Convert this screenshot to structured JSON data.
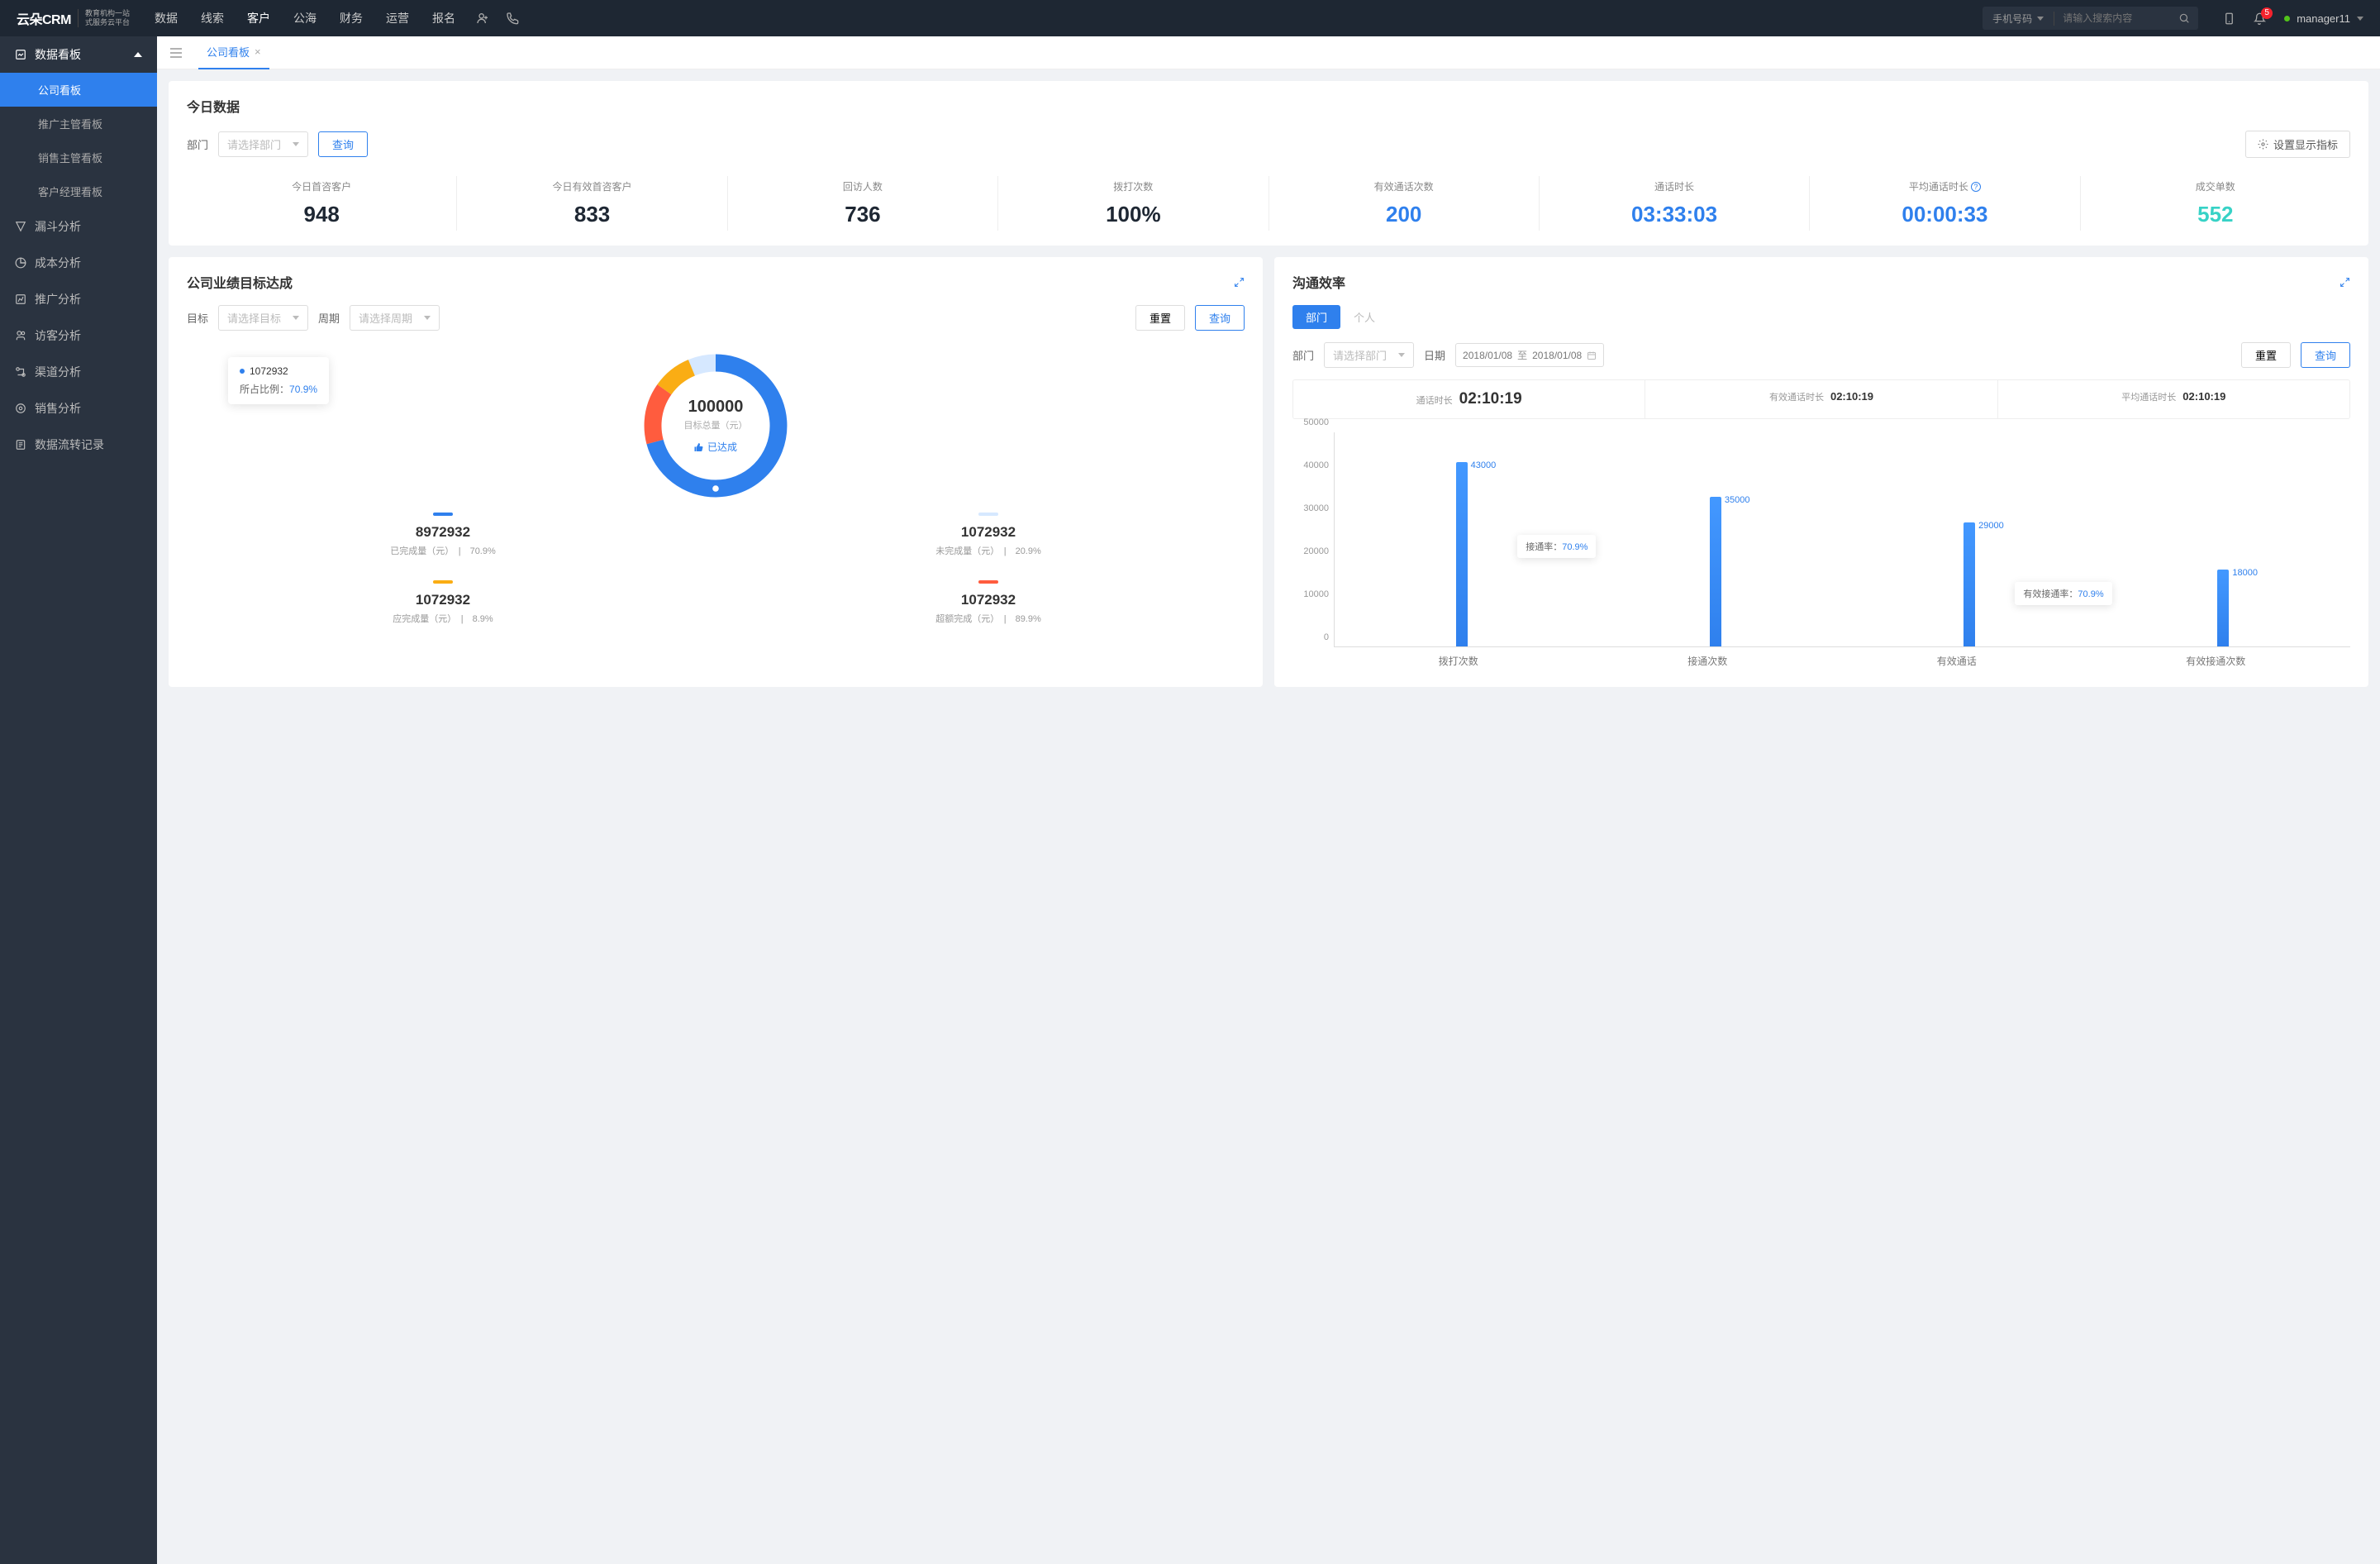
{
  "header": {
    "logo_main": "云朵CRM",
    "logo_sub1": "教育机构一站",
    "logo_sub2": "式服务云平台",
    "nav": [
      "数据",
      "线索",
      "客户",
      "公海",
      "财务",
      "运营",
      "报名"
    ],
    "nav_active_index": 2,
    "search_type": "手机号码",
    "search_placeholder": "请输入搜索内容",
    "badge_count": "5",
    "user_name": "manager11"
  },
  "sidebar": {
    "group": "数据看板",
    "subs": [
      "公司看板",
      "推广主管看板",
      "销售主管看板",
      "客户经理看板"
    ],
    "sub_active_index": 0,
    "items": [
      "漏斗分析",
      "成本分析",
      "推广分析",
      "访客分析",
      "渠道分析",
      "销售分析",
      "数据流转记录"
    ]
  },
  "tab": {
    "label": "公司看板"
  },
  "today": {
    "title": "今日数据",
    "dept_label": "部门",
    "dept_placeholder": "请选择部门",
    "query_btn": "查询",
    "settings_btn": "设置显示指标",
    "stats": [
      {
        "label": "今日首咨客户",
        "value": "948",
        "color": "c-dark"
      },
      {
        "label": "今日有效首咨客户",
        "value": "833",
        "color": "c-dark"
      },
      {
        "label": "回访人数",
        "value": "736",
        "color": "c-dark"
      },
      {
        "label": "拨打次数",
        "value": "100%",
        "color": "c-dark"
      },
      {
        "label": "有效通话次数",
        "value": "200",
        "color": "c-blue"
      },
      {
        "label": "通话时长",
        "value": "03:33:03",
        "color": "c-blue"
      },
      {
        "label": "平均通话时长",
        "value": "00:00:33",
        "color": "c-blue",
        "help": true
      },
      {
        "label": "成交单数",
        "value": "552",
        "color": "c-teal"
      }
    ]
  },
  "goal": {
    "title": "公司业绩目标达成",
    "target_label": "目标",
    "target_placeholder": "请选择目标",
    "period_label": "周期",
    "period_placeholder": "请选择周期",
    "reset_btn": "重置",
    "query_btn": "查询",
    "center_num": "100000",
    "center_sub": "目标总量（元）",
    "status": "已达成",
    "tooltip_val": "1072932",
    "tooltip_pct_lbl": "所占比例：",
    "tooltip_pct": "70.9%",
    "legend": [
      {
        "color": "#2f80ed",
        "num": "8972932",
        "txt": "已完成量（元）",
        "pct": "70.9%"
      },
      {
        "color": "#d6e8ff",
        "num": "1072932",
        "txt": "未完成量（元）",
        "pct": "20.9%"
      },
      {
        "color": "#faad14",
        "num": "1072932",
        "txt": "应完成量（元）",
        "pct": "8.9%"
      },
      {
        "color": "#ff5c3e",
        "num": "1072932",
        "txt": "超额完成（元）",
        "pct": "89.9%"
      }
    ]
  },
  "comm": {
    "title": "沟通效率",
    "pill_dept": "部门",
    "pill_person": "个人",
    "dept_label": "部门",
    "dept_placeholder": "请选择部门",
    "date_label": "日期",
    "date_from": "2018/01/08",
    "date_to": "2018/01/08",
    "date_sep": "至",
    "reset_btn": "重置",
    "query_btn": "查询",
    "kpis": [
      {
        "label": "通话时长",
        "value": "02:10:19"
      },
      {
        "label": "有效通话时长",
        "value": "02:10:19"
      },
      {
        "label": "平均通话时长",
        "value": "02:10:19"
      }
    ],
    "tooltip1_lbl": "接通率：",
    "tooltip1_val": "70.9%",
    "tooltip2_lbl": "有效接通率：",
    "tooltip2_val": "70.9%"
  },
  "chart_data": [
    {
      "type": "donut",
      "title": "公司业绩目标达成",
      "center_value": 100000,
      "center_label": "目标总量（元）",
      "status": "已达成",
      "series": [
        {
          "name": "已完成量（元）",
          "value": 8972932,
          "pct": 70.9,
          "color": "#2f80ed"
        },
        {
          "name": "未完成量（元）",
          "value": 1072932,
          "pct": 20.9,
          "color": "#d6e8ff"
        },
        {
          "name": "应完成量（元）",
          "value": 1072932,
          "pct": 8.9,
          "color": "#faad14"
        },
        {
          "name": "超额完成（元）",
          "value": 1072932,
          "pct": 89.9,
          "color": "#ff5c3e"
        }
      ]
    },
    {
      "type": "bar",
      "title": "沟通效率",
      "categories": [
        "拨打次数",
        "接通次数",
        "有效通话",
        "有效接通次数"
      ],
      "values": [
        43000,
        35000,
        29000,
        18000
      ],
      "ylabel": "",
      "xlabel": "",
      "ylim": [
        0,
        50000
      ],
      "y_ticks": [
        0,
        10000,
        20000,
        30000,
        40000,
        50000
      ],
      "annotations": [
        {
          "label": "接通率",
          "value": "70.9%"
        },
        {
          "label": "有效接通率",
          "value": "70.9%"
        }
      ]
    }
  ]
}
